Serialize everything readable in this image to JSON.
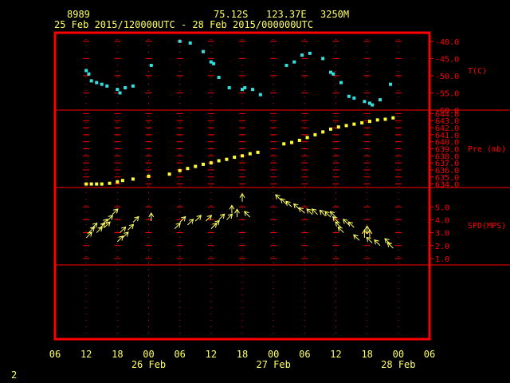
{
  "header": {
    "station_id": "8989",
    "lat": "75.12S",
    "lon": "123.37E",
    "elevation": "3250M",
    "time_range": "25 Feb 2015/120000UTC - 28 Feb 2015/000000UTC"
  },
  "page_number": "2",
  "colors": {
    "background": "#000000",
    "frame": "#ff0000",
    "grid": "#ff0000",
    "axis_text": "#ffff66",
    "temp": "#33e0e0",
    "pressure": "#ffff33",
    "wind": "#ffff66"
  },
  "chart_data": {
    "type": "scatter",
    "x_axis": {
      "unit": "hour of day (UTC)",
      "range": [
        "2015-02-25 06:00",
        "2015-02-28 06:00"
      ],
      "tick_labels": [
        "06",
        "12",
        "18",
        "00",
        "06",
        "12",
        "18",
        "00",
        "06",
        "12",
        "18",
        "00",
        "06"
      ],
      "date_labels": [
        {
          "label": "26 Feb",
          "at": "2015-02-26 00:00"
        },
        {
          "label": "27 Feb",
          "at": "2015-02-27 00:00"
        },
        {
          "label": "28 Feb",
          "at": "2015-02-28 00:00"
        }
      ]
    },
    "panels": [
      {
        "name": "temperature",
        "label": "T(C)",
        "ylim": [
          -60,
          -37.5
        ],
        "ticks": [
          "-40.0",
          "-45.0",
          "-50.0",
          "-55.0",
          "-60.0"
        ],
        "points": [
          [
            "2015-02-25 12:00",
            -48.5
          ],
          [
            "2015-02-25 12:30",
            -49.5
          ],
          [
            "2015-02-25 13:00",
            -51.5
          ],
          [
            "2015-02-25 14:00",
            -52.0
          ],
          [
            "2015-02-25 15:00",
            -52.5
          ],
          [
            "2015-02-25 16:00",
            -53.0
          ],
          [
            "2015-02-25 18:00",
            -54.0
          ],
          [
            "2015-02-25 18:30",
            -55.0
          ],
          [
            "2015-02-25 19:30",
            -53.5
          ],
          [
            "2015-02-25 21:00",
            -53.0
          ],
          [
            "2015-02-26 00:30",
            -47.0
          ],
          [
            "2015-02-26 06:00",
            -40.0
          ],
          [
            "2015-02-26 08:00",
            -40.5
          ],
          [
            "2015-02-26 10:30",
            -43.0
          ],
          [
            "2015-02-26 12:00",
            -46.0
          ],
          [
            "2015-02-26 12:30",
            -46.5
          ],
          [
            "2015-02-26 13:30",
            -50.5
          ],
          [
            "2015-02-26 15:30",
            -53.5
          ],
          [
            "2015-02-26 18:00",
            -54.0
          ],
          [
            "2015-02-26 18:30",
            -53.5
          ],
          [
            "2015-02-26 20:00",
            -54.0
          ],
          [
            "2015-02-26 21:30",
            -55.5
          ],
          [
            "2015-02-27 02:30",
            -47.0
          ],
          [
            "2015-02-27 04:00",
            -46.0
          ],
          [
            "2015-02-27 05:30",
            -44.0
          ],
          [
            "2015-02-27 07:00",
            -43.5
          ],
          [
            "2015-02-27 09:30",
            -45.0
          ],
          [
            "2015-02-27 11:00",
            -49.0
          ],
          [
            "2015-02-27 11:30",
            -49.5
          ],
          [
            "2015-02-27 13:00",
            -52.0
          ],
          [
            "2015-02-27 14:30",
            -56.0
          ],
          [
            "2015-02-27 15:30",
            -56.5
          ],
          [
            "2015-02-27 17:30",
            -57.5
          ],
          [
            "2015-02-27 18:30",
            -58.0
          ],
          [
            "2015-02-27 19:00",
            -58.5
          ],
          [
            "2015-02-27 20:30",
            -57.0
          ],
          [
            "2015-02-27 22:30",
            -52.5
          ]
        ]
      },
      {
        "name": "pressure",
        "label": "Pre (mb)",
        "ylim": [
          633.5,
          644.5
        ],
        "ticks": [
          "644.0",
          "643.0",
          "642.0",
          "641.0",
          "640.0",
          "639.0",
          "638.0",
          "637.0",
          "636.0",
          "635.0",
          "634.0"
        ],
        "points": [
          [
            "2015-02-25 12:00",
            634.0
          ],
          [
            "2015-02-25 13:00",
            634.0
          ],
          [
            "2015-02-25 14:00",
            634.0
          ],
          [
            "2015-02-25 15:00",
            634.0
          ],
          [
            "2015-02-25 16:30",
            634.1
          ],
          [
            "2015-02-25 18:00",
            634.3
          ],
          [
            "2015-02-25 19:00",
            634.5
          ],
          [
            "2015-02-25 21:00",
            634.7
          ],
          [
            "2015-02-26 00:00",
            635.1
          ],
          [
            "2015-02-26 04:00",
            635.4
          ],
          [
            "2015-02-26 06:00",
            635.9
          ],
          [
            "2015-02-26 07:30",
            636.2
          ],
          [
            "2015-02-26 09:00",
            636.5
          ],
          [
            "2015-02-26 10:30",
            636.8
          ],
          [
            "2015-02-26 12:00",
            637.0
          ],
          [
            "2015-02-26 13:30",
            637.3
          ],
          [
            "2015-02-26 15:00",
            637.5
          ],
          [
            "2015-02-26 16:30",
            637.8
          ],
          [
            "2015-02-26 18:00",
            638.0
          ],
          [
            "2015-02-26 19:30",
            638.3
          ],
          [
            "2015-02-26 21:00",
            638.5
          ],
          [
            "2015-02-27 02:00",
            639.7
          ],
          [
            "2015-02-27 03:30",
            639.9
          ],
          [
            "2015-02-27 05:00",
            640.2
          ],
          [
            "2015-02-27 06:30",
            640.6
          ],
          [
            "2015-02-27 08:00",
            641.0
          ],
          [
            "2015-02-27 09:30",
            641.4
          ],
          [
            "2015-02-27 11:00",
            641.8
          ],
          [
            "2015-02-27 12:30",
            642.1
          ],
          [
            "2015-02-27 14:00",
            642.3
          ],
          [
            "2015-02-27 15:30",
            642.5
          ],
          [
            "2015-02-27 17:00",
            642.7
          ],
          [
            "2015-02-27 18:30",
            642.9
          ],
          [
            "2015-02-27 20:00",
            643.1
          ],
          [
            "2015-02-27 21:30",
            643.2
          ],
          [
            "2015-02-27 23:00",
            643.4
          ]
        ]
      },
      {
        "name": "wind_speed",
        "label": "SPD(MPS)",
        "ylim": [
          0.5,
          6.5
        ],
        "ticks": [
          "5.0",
          "4.0",
          "3.0",
          "2.0",
          "1.0"
        ],
        "direction_note": "arrows show wind direction",
        "points": [
          [
            "2015-02-25 12:00",
            2.6,
            "NE"
          ],
          [
            "2015-02-25 12:30",
            3.0,
            "NE"
          ],
          [
            "2015-02-25 13:00",
            3.3,
            "NE"
          ],
          [
            "2015-02-25 14:00",
            3.0,
            "NE"
          ],
          [
            "2015-02-25 14:30",
            3.3,
            "NE"
          ],
          [
            "2015-02-25 15:00",
            3.6,
            "NE"
          ],
          [
            "2015-02-25 15:30",
            3.4,
            "NE"
          ],
          [
            "2015-02-25 16:00",
            3.9,
            "NE"
          ],
          [
            "2015-02-25 17:00",
            4.4,
            "NE"
          ],
          [
            "2015-02-25 18:00",
            2.3,
            "NE"
          ],
          [
            "2015-02-25 18:30",
            3.0,
            "NE"
          ],
          [
            "2015-02-25 19:00",
            2.6,
            "NE"
          ],
          [
            "2015-02-25 20:00",
            3.2,
            "NE"
          ],
          [
            "2015-02-25 21:00",
            3.8,
            "NE"
          ],
          [
            "2015-02-26 00:30",
            3.9,
            "N"
          ],
          [
            "2015-02-26 05:00",
            3.3,
            "NE"
          ],
          [
            "2015-02-26 06:00",
            3.8,
            "NE"
          ],
          [
            "2015-02-26 07:30",
            3.6,
            "NE"
          ],
          [
            "2015-02-26 09:00",
            3.9,
            "NE"
          ],
          [
            "2015-02-26 11:00",
            3.9,
            "NE"
          ],
          [
            "2015-02-26 12:00",
            3.3,
            "NE"
          ],
          [
            "2015-02-26 12:30",
            3.5,
            "NE"
          ],
          [
            "2015-02-26 13:30",
            4.0,
            "NE"
          ],
          [
            "2015-02-26 15:00",
            4.0,
            "NE"
          ],
          [
            "2015-02-26 16:00",
            4.5,
            "N"
          ],
          [
            "2015-02-26 17:00",
            4.2,
            "N"
          ],
          [
            "2015-02-26 18:00",
            5.4,
            "N"
          ],
          [
            "2015-02-26 19:30",
            4.2,
            "NW"
          ],
          [
            "2015-02-27 01:30",
            5.5,
            "NW"
          ],
          [
            "2015-02-27 02:30",
            5.2,
            "NW"
          ],
          [
            "2015-02-27 03:30",
            5.0,
            "NW"
          ],
          [
            "2015-02-27 05:00",
            4.8,
            "NW"
          ],
          [
            "2015-02-27 06:00",
            4.5,
            "NW"
          ],
          [
            "2015-02-27 07:30",
            4.4,
            "NW"
          ],
          [
            "2015-02-27 08:30",
            4.4,
            "NW"
          ],
          [
            "2015-02-27 10:00",
            4.3,
            "NW"
          ],
          [
            "2015-02-27 11:00",
            4.2,
            "NW"
          ],
          [
            "2015-02-27 12:00",
            4.2,
            "NW"
          ],
          [
            "2015-02-27 12:30",
            3.8,
            "NW"
          ],
          [
            "2015-02-27 13:00",
            3.4,
            "NW"
          ],
          [
            "2015-02-27 13:30",
            3.0,
            "NW"
          ],
          [
            "2015-02-27 14:30",
            3.6,
            "NW"
          ],
          [
            "2015-02-27 15:30",
            3.4,
            "NW"
          ],
          [
            "2015-02-27 16:30",
            2.4,
            "NW"
          ],
          [
            "2015-02-27 17:30",
            2.6,
            "N"
          ],
          [
            "2015-02-27 18:00",
            2.9,
            "N"
          ],
          [
            "2015-02-27 18:30",
            2.6,
            "N"
          ],
          [
            "2015-02-27 19:00",
            2.2,
            "NW"
          ],
          [
            "2015-02-27 20:30",
            2.0,
            "NW"
          ],
          [
            "2015-02-27 22:30",
            2.1,
            "NW"
          ],
          [
            "2015-02-27 23:00",
            1.8,
            "NW"
          ]
        ]
      }
    ]
  }
}
